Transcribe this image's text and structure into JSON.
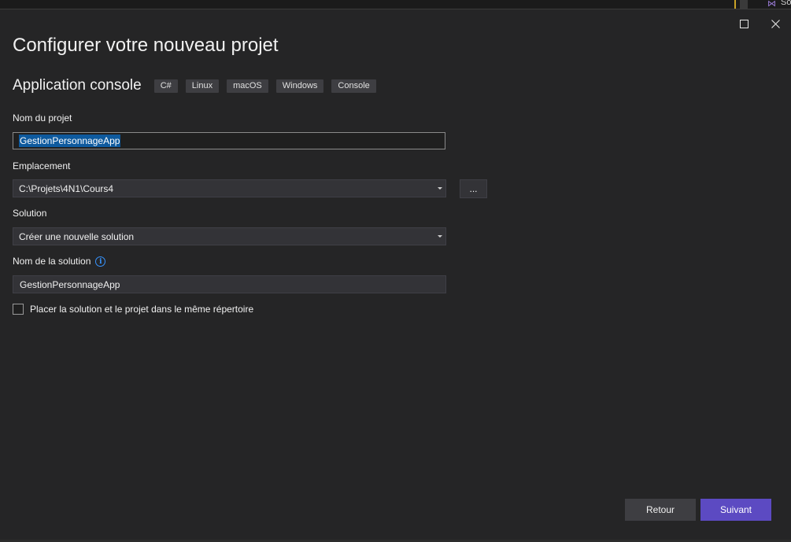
{
  "window": {
    "title": "Configurer votre nouveau projet",
    "background_ide_label": "So"
  },
  "template": {
    "name": "Application console",
    "tags": [
      "C#",
      "Linux",
      "macOS",
      "Windows",
      "Console"
    ]
  },
  "form": {
    "project_name_label": "Nom du projet",
    "project_name_value": "GestionPersonnageApp",
    "location_label": "Emplacement",
    "location_value": "C:\\Projets\\4N1\\Cours4",
    "browse_label": "...",
    "solution_label": "Solution",
    "solution_value": "Créer une nouvelle solution",
    "solution_name_label": "Nom de la solution",
    "solution_name_value": "GestionPersonnageApp",
    "same_directory_label": "Placer la solution et le projet dans le même répertoire",
    "same_directory_checked": false
  },
  "footer": {
    "back_label": "Retour",
    "next_label": "Suivant"
  },
  "colors": {
    "accent": "#5c4ac2",
    "selection": "#0e5a9e",
    "info": "#3794ff"
  },
  "icons": [
    "maximize-icon",
    "close-icon",
    "dropdown-arrow-icon",
    "info-icon",
    "checkbox-icon"
  ]
}
